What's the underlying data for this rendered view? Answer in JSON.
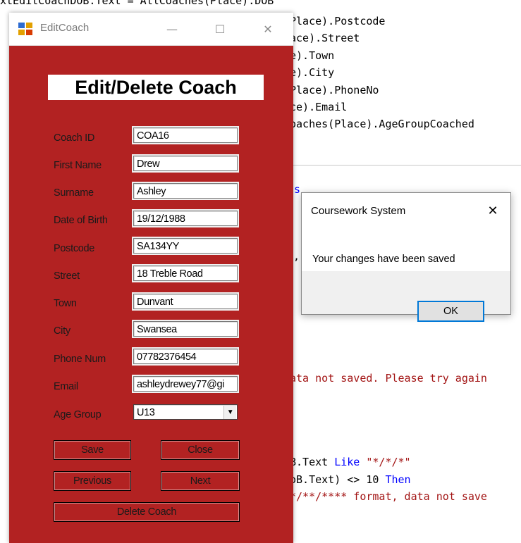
{
  "editor": {
    "lines": [
      {
        "pre": "xtEditCoachDOB.Text = AllCoaches(Place).DOB"
      },
      {
        "pre": "Place).Postcode"
      },
      {
        "pre": "ace).Street"
      },
      {
        "pre": "e).Town"
      },
      {
        "pre": "e).City"
      },
      {
        "pre": "Place).PhoneNo"
      },
      {
        "pre": "ce).Email"
      },
      {
        "pre": "oaches(Place).AgeGroupCoached"
      },
      {
        "pre": "s"
      },
      {
        "pre": ","
      },
      {
        "pre": "ata not saved. Please try again"
      },
      {
        "pre": "B.Text ",
        "kw": "Like",
        "post": " ",
        "str": "\"*/*/*\""
      },
      {
        "pre": "oB.Text) <> 10 ",
        "kw": "Then"
      },
      {
        "str": "*/**/**** format, data not save"
      }
    ]
  },
  "window": {
    "title": "EditCoach",
    "minimize": "—",
    "maximize": "☐",
    "close": "✕",
    "form_title": "Edit/Delete Coach"
  },
  "fields": [
    {
      "label": "Coach ID",
      "value": "COA16"
    },
    {
      "label": "First Name",
      "value": "Drew"
    },
    {
      "label": "Surname",
      "value": "Ashley"
    },
    {
      "label": "Date of Birth",
      "value": "19/12/1988"
    },
    {
      "label": "Postcode",
      "value": "SA134YY"
    },
    {
      "label": "Street",
      "value": "18 Treble Road"
    },
    {
      "label": "Town",
      "value": "Dunvant"
    },
    {
      "label": "City",
      "value": "Swansea"
    },
    {
      "label": "Phone Num",
      "value": "07782376454"
    },
    {
      "label": "Email",
      "value": "ashleydrewey77@gi"
    },
    {
      "label": "Age Group",
      "value": "U13"
    }
  ],
  "buttons": {
    "save": "Save",
    "close": "Close",
    "previous": "Previous",
    "next": "Next",
    "delete": "Delete Coach"
  },
  "msgbox": {
    "title": "Coursework System",
    "close": "✕",
    "text": "Your changes have been saved",
    "ok": "OK"
  },
  "colors": {
    "form_bg": "#b22222",
    "ok_border": "#0078d7",
    "keyword": "#0000ff",
    "string": "#a31515"
  }
}
